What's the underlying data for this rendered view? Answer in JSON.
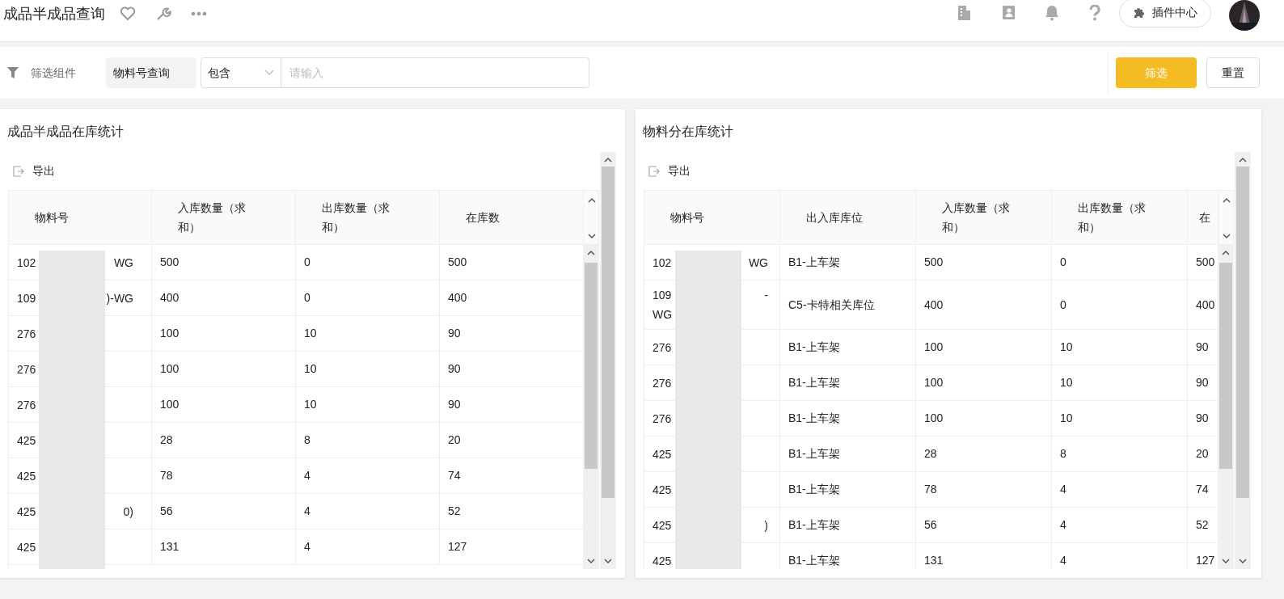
{
  "header": {
    "title": "成品半成品查询",
    "plugin_button": "插件中心"
  },
  "filter": {
    "label": "筛选组件",
    "field_label": "物料号查询",
    "operator": "包含",
    "input": {
      "placeholder": "请输入"
    },
    "buttons": [
      {
        "label": "筛选",
        "kind": "primary"
      },
      {
        "label": "重置",
        "kind": "default"
      }
    ]
  },
  "panels": [
    {
      "title": "成品半成品在库统计",
      "export": "导出",
      "table": {
        "material_column": "物料号",
        "columns": [
          "入库数量（求和）",
          "出库数量（求和）",
          "在库数"
        ],
        "rows": [
          {
            "material": [
              {
                "start": "102",
                "end": "WG"
              }
            ],
            "cells": [
              "500",
              "0",
              "500"
            ]
          },
          {
            "material": [
              {
                "start": "109",
                "end": ")-WG"
              }
            ],
            "cells": [
              "400",
              "0",
              "400"
            ]
          },
          {
            "material": [
              {
                "start": "276"
              }
            ],
            "cells": [
              "100",
              "10",
              "90"
            ]
          },
          {
            "material": [
              {
                "start": "276"
              }
            ],
            "cells": [
              "100",
              "10",
              "90"
            ]
          },
          {
            "material": [
              {
                "start": "276"
              }
            ],
            "cells": [
              "100",
              "10",
              "90"
            ]
          },
          {
            "material": [
              {
                "start": "425"
              }
            ],
            "cells": [
              "28",
              "8",
              "20"
            ]
          },
          {
            "material": [
              {
                "start": "425"
              }
            ],
            "cells": [
              "78",
              "4",
              "74"
            ]
          },
          {
            "material": [
              {
                "start": "425",
                "end": "0)"
              }
            ],
            "cells": [
              "56",
              "4",
              "52"
            ]
          },
          {
            "material": [
              {
                "start": "425"
              }
            ],
            "cells": [
              "131",
              "4",
              "127"
            ]
          }
        ]
      }
    },
    {
      "title": "物料分在库统计",
      "export": "导出",
      "table": {
        "material_column": "物料号",
        "columns": [
          "出入库库位",
          "入库数量（求和）",
          "出库数量（求和）",
          "在"
        ],
        "rows": [
          {
            "material": [
              {
                "start": "102",
                "end": "WG"
              }
            ],
            "cells": [
              "B1-上车架",
              "500",
              "0",
              "500"
            ]
          },
          {
            "material": [
              {
                "start": "109",
                "end": "-"
              },
              {
                "start": "WG"
              }
            ],
            "cells": [
              "C5-卡特相关库位",
              "400",
              "0",
              "400"
            ]
          },
          {
            "material": [
              {
                "start": "276"
              }
            ],
            "cells": [
              "B1-上车架",
              "100",
              "10",
              "90"
            ]
          },
          {
            "material": [
              {
                "start": "276"
              }
            ],
            "cells": [
              "B1-上车架",
              "100",
              "10",
              "90"
            ]
          },
          {
            "material": [
              {
                "start": "276"
              }
            ],
            "cells": [
              "B1-上车架",
              "100",
              "10",
              "90"
            ]
          },
          {
            "material": [
              {
                "start": "425"
              }
            ],
            "cells": [
              "B1-上车架",
              "28",
              "8",
              "20"
            ]
          },
          {
            "material": [
              {
                "start": "425"
              }
            ],
            "cells": [
              "B1-上车架",
              "78",
              "4",
              "74"
            ]
          },
          {
            "material": [
              {
                "start": "425",
                "end": ")"
              }
            ],
            "cells": [
              "B1-上车架",
              "56",
              "4",
              "52"
            ]
          },
          {
            "material": [
              {
                "start": "425"
              }
            ],
            "cells": [
              "B1-上车架",
              "131",
              "4",
              "127"
            ]
          }
        ]
      }
    }
  ]
}
